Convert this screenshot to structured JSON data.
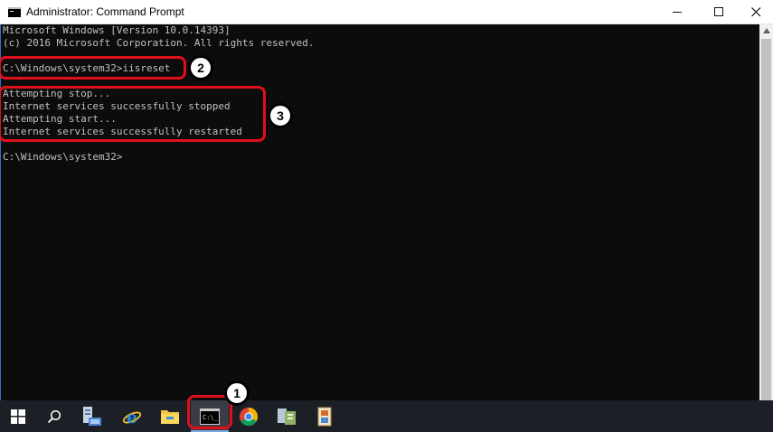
{
  "window": {
    "title": "Administrator: Command Prompt",
    "controls": {
      "minimize": "—",
      "maximize": "☐",
      "close": "✕"
    }
  },
  "console": {
    "lines": [
      "Microsoft Windows [Version 10.0.14393]",
      "(c) 2016 Microsoft Corporation. All rights reserved.",
      "",
      "C:\\Windows\\system32>iisreset",
      "",
      "Attempting stop...",
      "Internet services successfully stopped",
      "Attempting start...",
      "Internet services successfully restarted",
      "",
      "C:\\Windows\\system32>"
    ]
  },
  "annotations": {
    "step1": "1",
    "step2": "2",
    "step3": "3",
    "color": "#e0101b"
  },
  "taskbar": {
    "items": [
      {
        "icon": "start-windows-icon"
      },
      {
        "icon": "search-icon"
      },
      {
        "icon": "server-manager-icon"
      },
      {
        "icon": "internet-explorer-icon"
      },
      {
        "icon": "file-explorer-icon"
      },
      {
        "icon": "command-prompt-icon",
        "active": true
      },
      {
        "icon": "chrome-icon"
      },
      {
        "icon": "iis-manager-icon"
      },
      {
        "icon": "installer-icon"
      }
    ]
  }
}
